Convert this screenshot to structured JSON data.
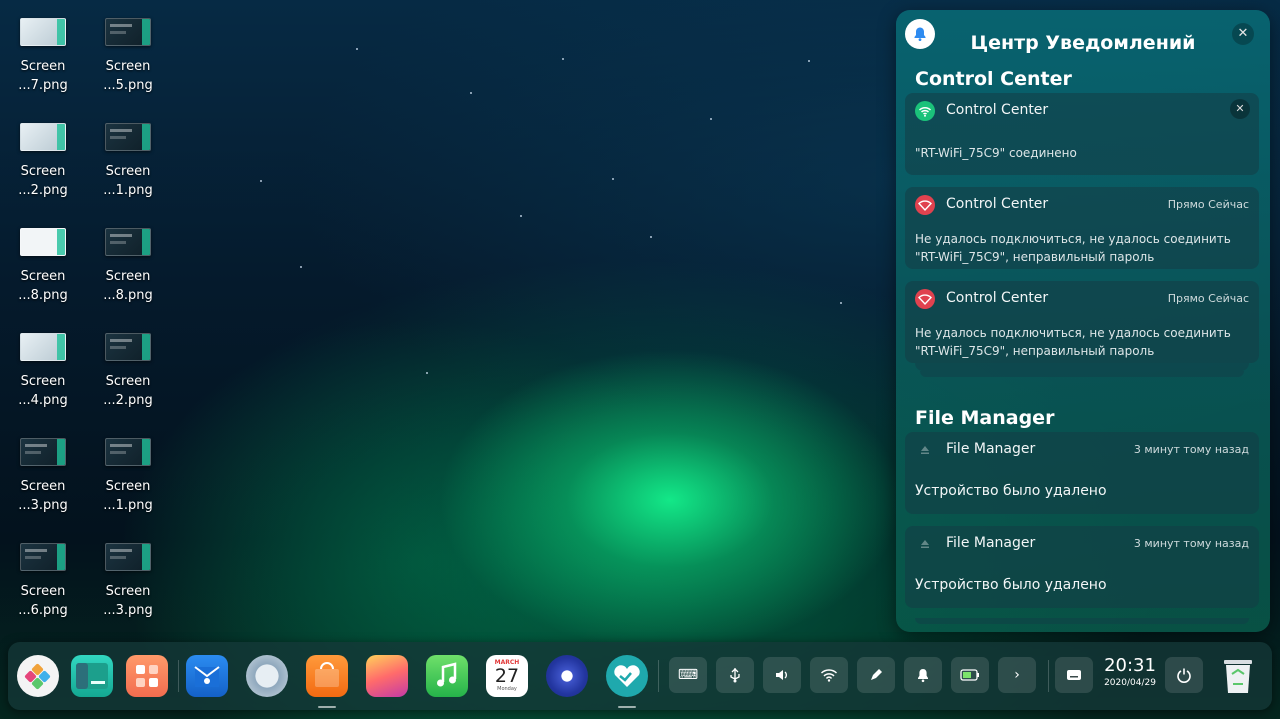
{
  "desktop": {
    "icons": [
      {
        "line1": "Screen",
        "line2": "...7.png"
      },
      {
        "line1": "Screen",
        "line2": "...5.png"
      },
      {
        "line1": "Screen",
        "line2": "...2.png"
      },
      {
        "line1": "Screen",
        "line2": "...1.png"
      },
      {
        "line1": "Screen",
        "line2": "...8.png"
      },
      {
        "line1": "Screen",
        "line2": "...8.png"
      },
      {
        "line1": "Screen",
        "line2": "...4.png"
      },
      {
        "line1": "Screen",
        "line2": "...2.png"
      },
      {
        "line1": "Screen",
        "line2": "...3.png"
      },
      {
        "line1": "Screen",
        "line2": "...1.png"
      },
      {
        "line1": "Screen",
        "line2": "...6.png"
      },
      {
        "line1": "Screen",
        "line2": "...3.png"
      }
    ]
  },
  "notification_center": {
    "title": "Центр Уведомлений",
    "groups": [
      {
        "title": "Control Center",
        "notifications": [
          {
            "app": "Control Center",
            "time": "",
            "body": "\"RT-WiFi_75C9\" соединено",
            "icon": "wifi-icon"
          },
          {
            "app": "Control Center",
            "time": "Прямо Сейчас",
            "body": "Не удалось подключиться, не удалось соединить \"RT-WiFi_75C9\", неправильный пароль",
            "icon": "wifi-error-icon"
          },
          {
            "app": "Control Center",
            "time": "Прямо Сейчас",
            "body": "Не удалось подключиться, не удалось соединить \"RT-WiFi_75C9\", неправильный пароль",
            "icon": "wifi-error-icon"
          }
        ]
      },
      {
        "title": "File Manager",
        "notifications": [
          {
            "app": "File Manager",
            "time": "3 минут тому назад",
            "body": "Устройство было удалено",
            "icon": "eject-icon"
          },
          {
            "app": "File Manager",
            "time": "3 минут тому назад",
            "body": "Устройство было удалено",
            "icon": "eject-icon"
          }
        ]
      }
    ]
  },
  "dock": {
    "apps": [
      "launcher-icon",
      "file-manager-icon",
      "app-store-grid-icon",
      "mail-icon",
      "browser-icon",
      "store-bag-icon",
      "photos-icon",
      "music-icon",
      "calendar-icon",
      "settings-icon",
      "support-icon"
    ],
    "calendar": {
      "month": "MARCH",
      "day": "27",
      "weekday": "Monday"
    },
    "tray": [
      "keyboard-icon",
      "usb-icon",
      "volume-icon",
      "wifi-icon",
      "pen-icon",
      "bell-icon",
      "battery-icon",
      "chevron-right-icon"
    ],
    "clock": {
      "time": "20:31",
      "date": "2020/04/29"
    }
  }
}
